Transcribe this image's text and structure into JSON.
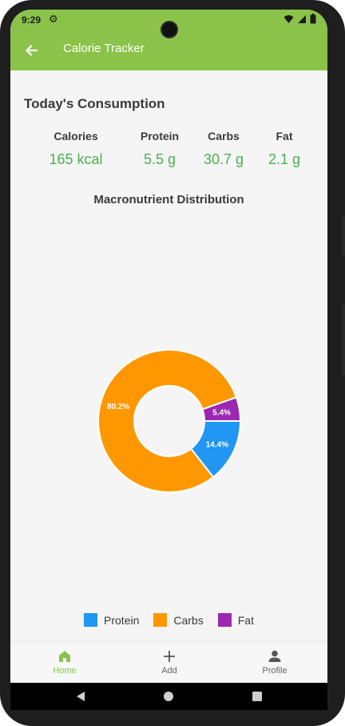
{
  "status_bar": {
    "time": "9:29"
  },
  "app_bar": {
    "title": "Calorie Tracker"
  },
  "summary": {
    "title": "Today's Consumption",
    "stats": [
      {
        "label": "Calories",
        "value": "165 kcal"
      },
      {
        "label": "Protein",
        "value": "5.5 g"
      },
      {
        "label": "Carbs",
        "value": "30.7 g"
      },
      {
        "label": "Fat",
        "value": "2.1 g"
      }
    ]
  },
  "distribution": {
    "title": "Macronutrient Distribution"
  },
  "chart_data": {
    "type": "pie",
    "categories": [
      "Protein",
      "Carbs",
      "Fat"
    ],
    "values": [
      14.4,
      80.2,
      5.4
    ],
    "labels": [
      "14.4%",
      "80.2%",
      "5.4%"
    ],
    "colors": [
      "#2196f3",
      "#ff9800",
      "#9c27b0"
    ],
    "donut": true,
    "legend": "bottom"
  },
  "legend": [
    {
      "name": "Protein",
      "color": "#2196f3"
    },
    {
      "name": "Carbs",
      "color": "#ff9800"
    },
    {
      "name": "Fat",
      "color": "#9c27b0"
    }
  ],
  "bottom_nav": [
    {
      "label": "Home",
      "icon": "home-icon",
      "active": true
    },
    {
      "label": "Add",
      "icon": "plus-icon",
      "active": false
    },
    {
      "label": "Profile",
      "icon": "person-icon",
      "active": false
    }
  ],
  "colors": {
    "primary": "#8bc34a",
    "accent_text": "#4caf50"
  }
}
